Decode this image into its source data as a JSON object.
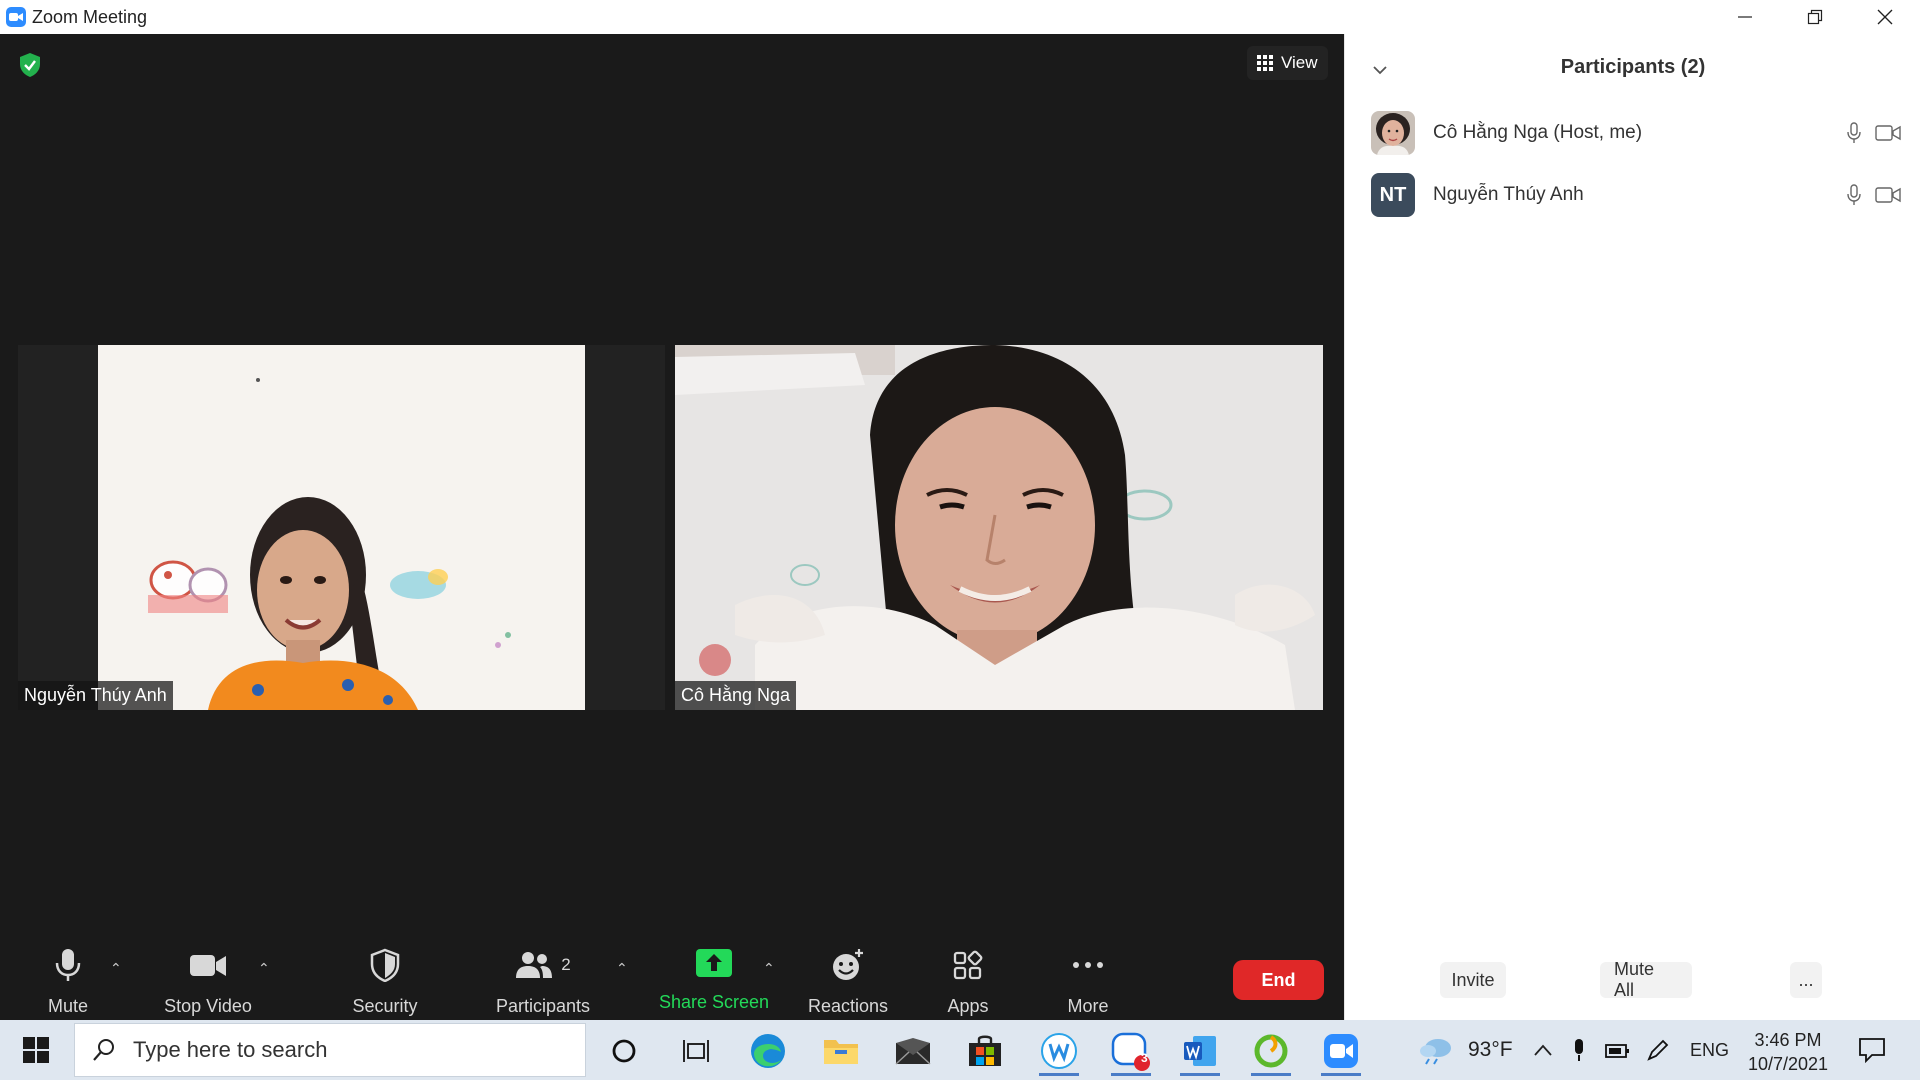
{
  "window": {
    "title": "Zoom Meeting"
  },
  "meeting": {
    "view_label": "View",
    "tiles": [
      {
        "name": "Nguyễn Thúy Anh"
      },
      {
        "name": "Cô Hằng Nga"
      }
    ]
  },
  "toolbar": {
    "mute": "Mute",
    "stop_video": "Stop Video",
    "security": "Security",
    "participants": "Participants",
    "participants_count": "2",
    "share_screen": "Share Screen",
    "reactions": "Reactions",
    "apps": "Apps",
    "more": "More",
    "end": "End"
  },
  "panel": {
    "title": "Participants (2)",
    "participants": [
      {
        "name": "Cô Hằng Nga (Host, me)",
        "avatar": "photo"
      },
      {
        "name": "Nguyễn Thúy Anh",
        "initials": "NT"
      }
    ],
    "invite": "Invite",
    "mute_all": "Mute All",
    "more": "..."
  },
  "taskbar": {
    "search_placeholder": "Type here to search",
    "zoom_badge": "3",
    "weather": "93°F",
    "lang": "ENG",
    "time": "3:46 PM",
    "date": "10/7/2021"
  },
  "colors": {
    "meeting_bg": "#1a1a1a",
    "share_green": "#23d959",
    "end_red": "#e02828",
    "taskbar_bg": "#dfe7f0",
    "zoom_blue": "#2d8cff"
  }
}
